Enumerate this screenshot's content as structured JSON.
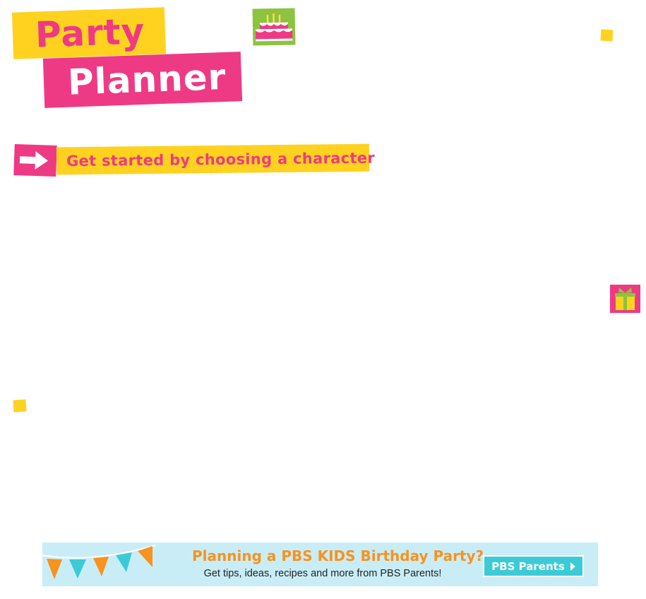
{
  "header": {
    "title_line1": "Party",
    "title_line2": "Planner"
  },
  "icons": {
    "cake": "birthday-cake-icon",
    "gift": "gift-icon",
    "arrow": "arrow-right-icon"
  },
  "prompt": {
    "text": "Get started by choosing a character"
  },
  "banner": {
    "heading": "Planning a PBS KIDS Birthday Party?",
    "subtext": "Get tips, ideas, recipes and more from PBS Parents!",
    "button_label": "PBS Parents"
  },
  "colors": {
    "pink": "#EE3A84",
    "yellow": "#FFD21F",
    "green": "#8BC43F",
    "banner_bg": "#C9EDF7",
    "orange": "#F7931E",
    "teal": "#3CCBD6"
  }
}
